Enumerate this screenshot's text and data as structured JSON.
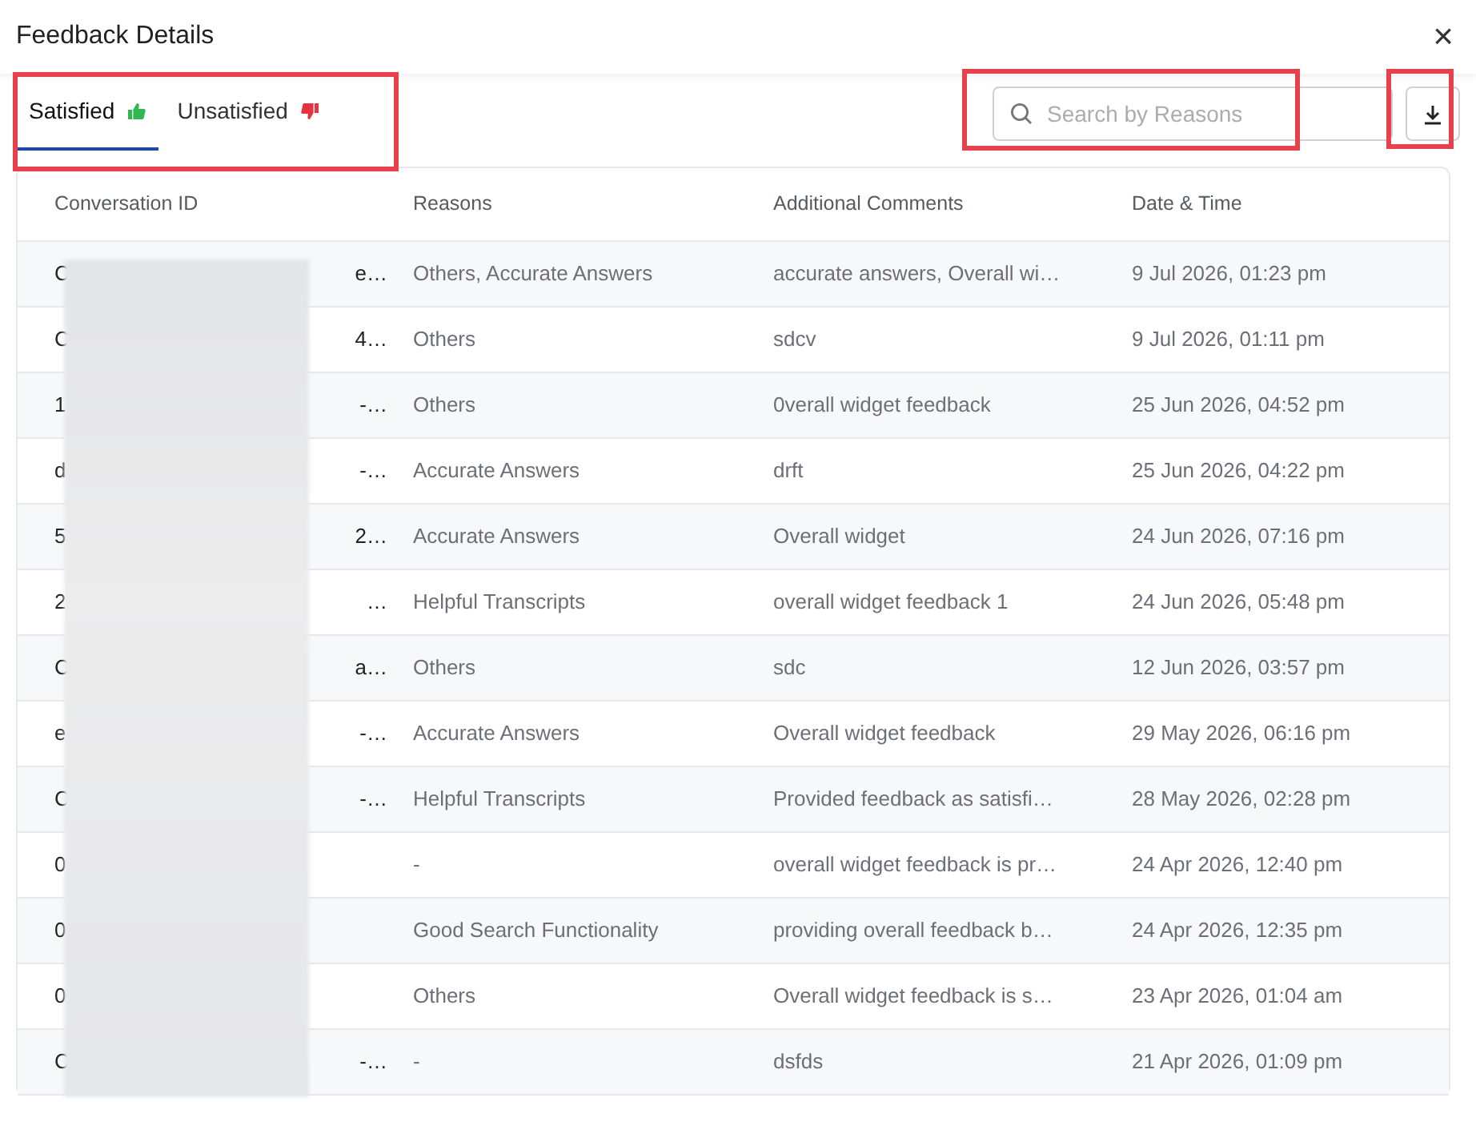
{
  "window": {
    "title": "Feedback Details",
    "close": "×"
  },
  "tabs": [
    {
      "label": "Satisfied",
      "kind": "up",
      "selected": true
    },
    {
      "label": "Unsatisfied",
      "kind": "down",
      "selected": false
    }
  ],
  "search": {
    "placeholder": "Search by Reasons"
  },
  "table": {
    "columns": [
      "Conversation ID",
      "Reasons",
      "Additional Comments",
      "Date & Time"
    ],
    "rows": [
      {
        "id_start": "C",
        "id_end": "e…",
        "reasons": "Others, Accurate Answers",
        "comments": "accurate answers, Overall wi…",
        "date": "9 Jul 2026, 01:23 pm"
      },
      {
        "id_start": "C",
        "id_end": "4…",
        "reasons": "Others",
        "comments": "sdcv",
        "date": "9 Jul 2026, 01:11 pm"
      },
      {
        "id_start": "1",
        "id_end": "-…",
        "reasons": "Others",
        "comments": "0verall widget feedback",
        "date": "25 Jun 2026, 04:52 pm"
      },
      {
        "id_start": "d",
        "id_end": "-…",
        "reasons": "Accurate Answers",
        "comments": "drft",
        "date": "25 Jun 2026, 04:22 pm"
      },
      {
        "id_start": "5",
        "id_end": "2…",
        "reasons": "Accurate Answers",
        "comments": "Overall widget",
        "date": "24 Jun 2026, 07:16 pm"
      },
      {
        "id_start": "2",
        "id_end": "…",
        "reasons": "Helpful Transcripts",
        "comments": "overall widget feedback 1",
        "date": "24 Jun 2026, 05:48 pm"
      },
      {
        "id_start": "C",
        "id_end": "a…",
        "reasons": "Others",
        "comments": "sdc",
        "date": "12 Jun 2026, 03:57 pm"
      },
      {
        "id_start": "e",
        "id_end": "-…",
        "reasons": "Accurate Answers",
        "comments": "Overall widget feedback",
        "date": "29 May 2026, 06:16 pm"
      },
      {
        "id_start": "C",
        "id_end": "-…",
        "reasons": "Helpful Transcripts",
        "comments": "Provided feedback as satisfi…",
        "date": "28 May 2026, 02:28 pm"
      },
      {
        "id_start": "0",
        "reasons": "-",
        "comments": "overall widget feedback is pr…",
        "date": "24 Apr 2026, 12:40 pm"
      },
      {
        "id_start": "0",
        "reasons": "Good Search Functionality",
        "comments": "providing overall feedback b…",
        "date": "24 Apr 2026, 12:35 pm"
      },
      {
        "id_start": "0",
        "reasons": "Others",
        "comments": "Overall widget feedback is s…",
        "date": "23 Apr 2026, 01:04 am"
      },
      {
        "id_start": "C",
        "id_end": "-…",
        "reasons": "-",
        "comments": "dsfds",
        "date": "21 Apr 2026, 01:09 pm"
      }
    ]
  }
}
